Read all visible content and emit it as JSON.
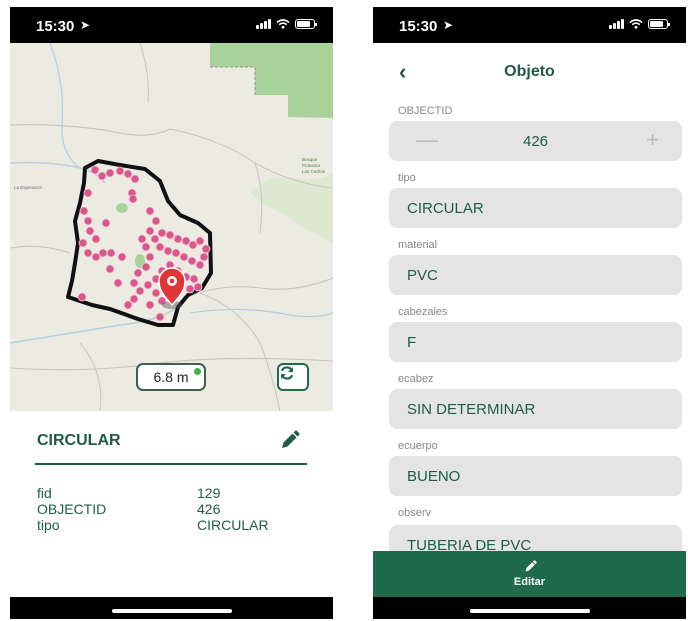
{
  "left_phone": {
    "status": {
      "time": "15:30",
      "location_icon": "location-arrow-icon"
    },
    "map": {
      "place_label_1": "Bosque\nProtector\nLos Cedros",
      "place_label_2": "La Esperanza",
      "gps_accuracy": "6.8 m",
      "gps_status_color": "#3bb14a",
      "point_color": "#d9588c",
      "boundary_color": "#111111"
    },
    "info": {
      "title": "CIRCULAR",
      "rows": [
        {
          "key": "fid",
          "value": "129"
        },
        {
          "key": "OBJECTID",
          "value": "426"
        },
        {
          "key": "tipo",
          "value": "CIRCULAR"
        }
      ]
    }
  },
  "right_phone": {
    "status": {
      "time": "15:30"
    },
    "header": {
      "back_icon": "chevron-left-icon",
      "title": "Objeto"
    },
    "objectid_field": {
      "label": "OBJECTID",
      "value": "426"
    },
    "fields": [
      {
        "label": "tipo",
        "value": "CIRCULAR"
      },
      {
        "label": "material",
        "value": "PVC"
      },
      {
        "label": "cabezales",
        "value": "F"
      },
      {
        "label": "ecabez",
        "value": "SIN DETERMINAR"
      },
      {
        "label": "ecuerpo",
        "value": "BUENO"
      },
      {
        "label": "observ",
        "value": "TUBERIA DE PVC"
      }
    ],
    "edit_button": {
      "label": "Editar"
    }
  },
  "colors": {
    "brand_green": "#1e6a4b",
    "text_green": "#1f5b4a",
    "field_bg": "#e4e4e4"
  }
}
